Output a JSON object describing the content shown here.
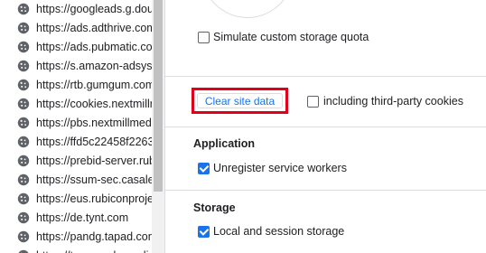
{
  "origins": [
    {
      "text": "https://googleads.g.dou",
      "icon": "cookie-icon"
    },
    {
      "text": "https://ads.adthrive.com",
      "icon": "cookie-icon"
    },
    {
      "text": "https://ads.pubmatic.com",
      "icon": "cookie-icon"
    },
    {
      "text": "https://s.amazon-adsyst",
      "icon": "cookie-icon"
    },
    {
      "text": "https://rtb.gumgum.com",
      "icon": "cookie-icon"
    },
    {
      "text": "https://cookies.nextmillr",
      "icon": "cookie-icon"
    },
    {
      "text": "https://pbs.nextmillmed",
      "icon": "cookie-icon"
    },
    {
      "text": "https://ffd5c22458f2263",
      "icon": "cookie-icon"
    },
    {
      "text": "https://prebid-server.rub",
      "icon": "cookie-icon"
    },
    {
      "text": "https://ssum-sec.casaler",
      "icon": "cookie-icon"
    },
    {
      "text": "https://eus.rubiconproje",
      "icon": "cookie-icon"
    },
    {
      "text": "https://de.tynt.com",
      "icon": "cookie-icon"
    },
    {
      "text": "https://pandg.tapad.con",
      "icon": "cookie-icon"
    },
    {
      "text": "https://tpc.googlesyndic",
      "icon": "cookie-icon"
    }
  ],
  "storage_panel": {
    "simulate_quota_label": "Simulate custom storage quota",
    "simulate_quota_checked": false,
    "clear_button_label": "Clear site data",
    "third_party_label": "including third-party cookies",
    "third_party_checked": false
  },
  "application": {
    "title": "Application",
    "unregister_label": "Unregister service workers",
    "unregister_checked": true
  },
  "storage": {
    "title": "Storage",
    "local_session_label": "Local and session storage",
    "local_session_checked": true
  },
  "colors": {
    "accent": "#1a73e8",
    "highlight_border": "#e0001b",
    "divider": "#dadce0"
  }
}
